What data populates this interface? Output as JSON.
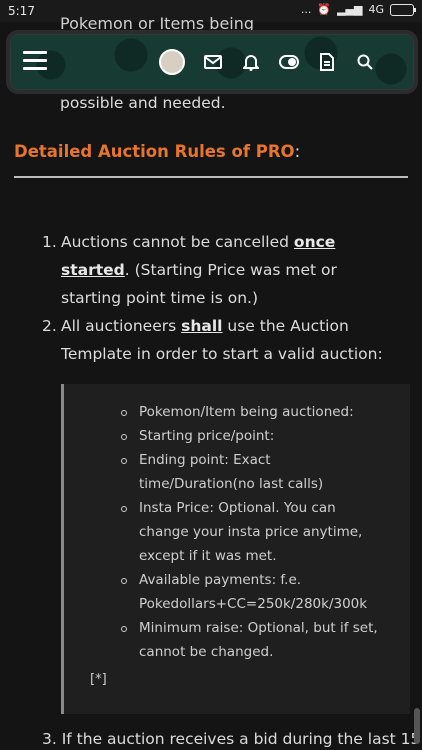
{
  "status": {
    "time": "5:17",
    "network": "4G",
    "dots": "..."
  },
  "partial_top_text": "Pokemon or Items being",
  "nav": {
    "avatar_alt": "user avatar"
  },
  "content": {
    "prev_line": "possible and needed.",
    "heading": "Detailed Auction Rules of PRO",
    "heading_colon": ":",
    "items": [
      {
        "num": "1.",
        "pre": "Auctions cannot be cancelled ",
        "u": "once started",
        "post": ". (Starting Price was met or starting point time is on.)"
      },
      {
        "num": "2.",
        "pre": "All auctioneers ",
        "u": "shall",
        "post": " use the Auction Template in order to start a valid auction:"
      }
    ],
    "template": [
      "Pokemon/Item being auctioned:",
      "Starting price/point:",
      "Ending point: Exact time/Duration(no last calls)",
      "Insta Price: Optional. You can change your insta price anytime, except if it was met.",
      "Available payments: f.e. Pokedollars+CC=250k/280k/300k",
      "Minimum raise: Optional, but if set, cannot be changed."
    ],
    "star": "[*]",
    "item3": "3. If the auction receives a bid during the last 15"
  }
}
